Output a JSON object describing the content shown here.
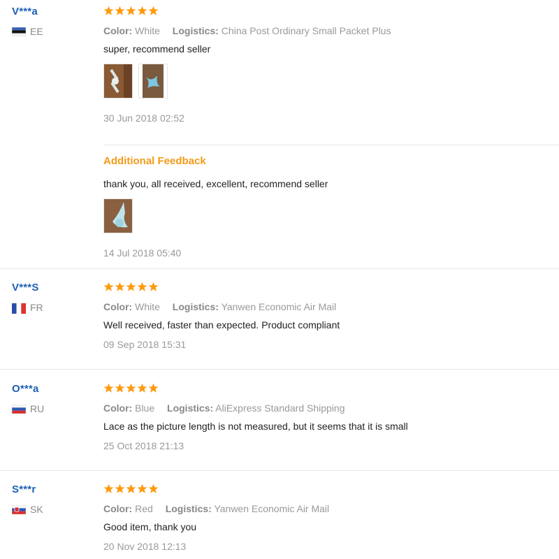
{
  "colors": {
    "star": "#ff9a0e",
    "link": "#1f5fb4",
    "muted": "#999999",
    "feedback_title": "#f39a17"
  },
  "labels": {
    "color": "Color:",
    "logistics": "Logistics:"
  },
  "reviews": [
    {
      "user": "V***a",
      "country": "EE",
      "flag": "estonia-flag-icon",
      "stars": 5,
      "color": "White",
      "logistics": "China Post Ordinary Small Packet Plus",
      "text": "super, recommend seller",
      "photos": [
        "review-photo-1",
        "review-photo-2"
      ],
      "date": "30 Jun 2018 02:52",
      "additional": {
        "title": "Additional Feedback",
        "text": "thank you, all received, excellent, recommend seller",
        "photos": [
          "additional-photo-1"
        ],
        "date": "14 Jul 2018 05:40"
      }
    },
    {
      "user": "V***S",
      "country": "FR",
      "flag": "france-flag-icon",
      "stars": 5,
      "color": "White",
      "logistics": "Yanwen Economic Air Mail",
      "text": "Well received, faster than expected. Product compliant",
      "date": "09 Sep 2018 15:31"
    },
    {
      "user": "O***a",
      "country": "RU",
      "flag": "russia-flag-icon",
      "stars": 5,
      "color": "Blue",
      "logistics": "AliExpress Standard Shipping",
      "text": "Lace as the picture length is not measured, but it seems that it is small",
      "date": "25 Oct 2018 21:13"
    },
    {
      "user": "S***r",
      "country": "SK",
      "flag": "slovakia-flag-icon",
      "stars": 5,
      "color": "Red",
      "logistics": "Yanwen Economic Air Mail",
      "text": "Good item, thank you",
      "date": "20 Nov 2018 12:13"
    }
  ]
}
